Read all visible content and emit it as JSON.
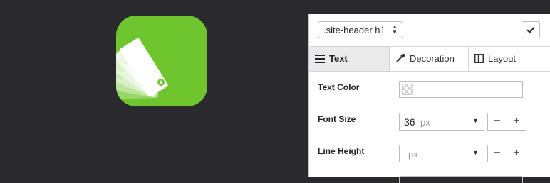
{
  "app_icon": {
    "name": "swatch-app-icon",
    "color": "#6ec52e"
  },
  "panel": {
    "selector": {
      "value": ".site-header h1"
    },
    "tabs": [
      {
        "label": "Text",
        "icon": "text-align-icon",
        "active": true
      },
      {
        "label": "Decoration",
        "icon": "eyedropper-icon",
        "active": false
      },
      {
        "label": "Layout",
        "icon": "layout-columns-icon",
        "active": false
      }
    ],
    "properties": {
      "text_color": {
        "label": "Text Color"
      },
      "font_size": {
        "label": "Font Size",
        "value": "36",
        "unit": "px",
        "minus": "−",
        "plus": "+"
      },
      "line_height": {
        "label": "Line Height",
        "value": "",
        "unit": "px",
        "minus": "−",
        "plus": "+"
      }
    }
  }
}
